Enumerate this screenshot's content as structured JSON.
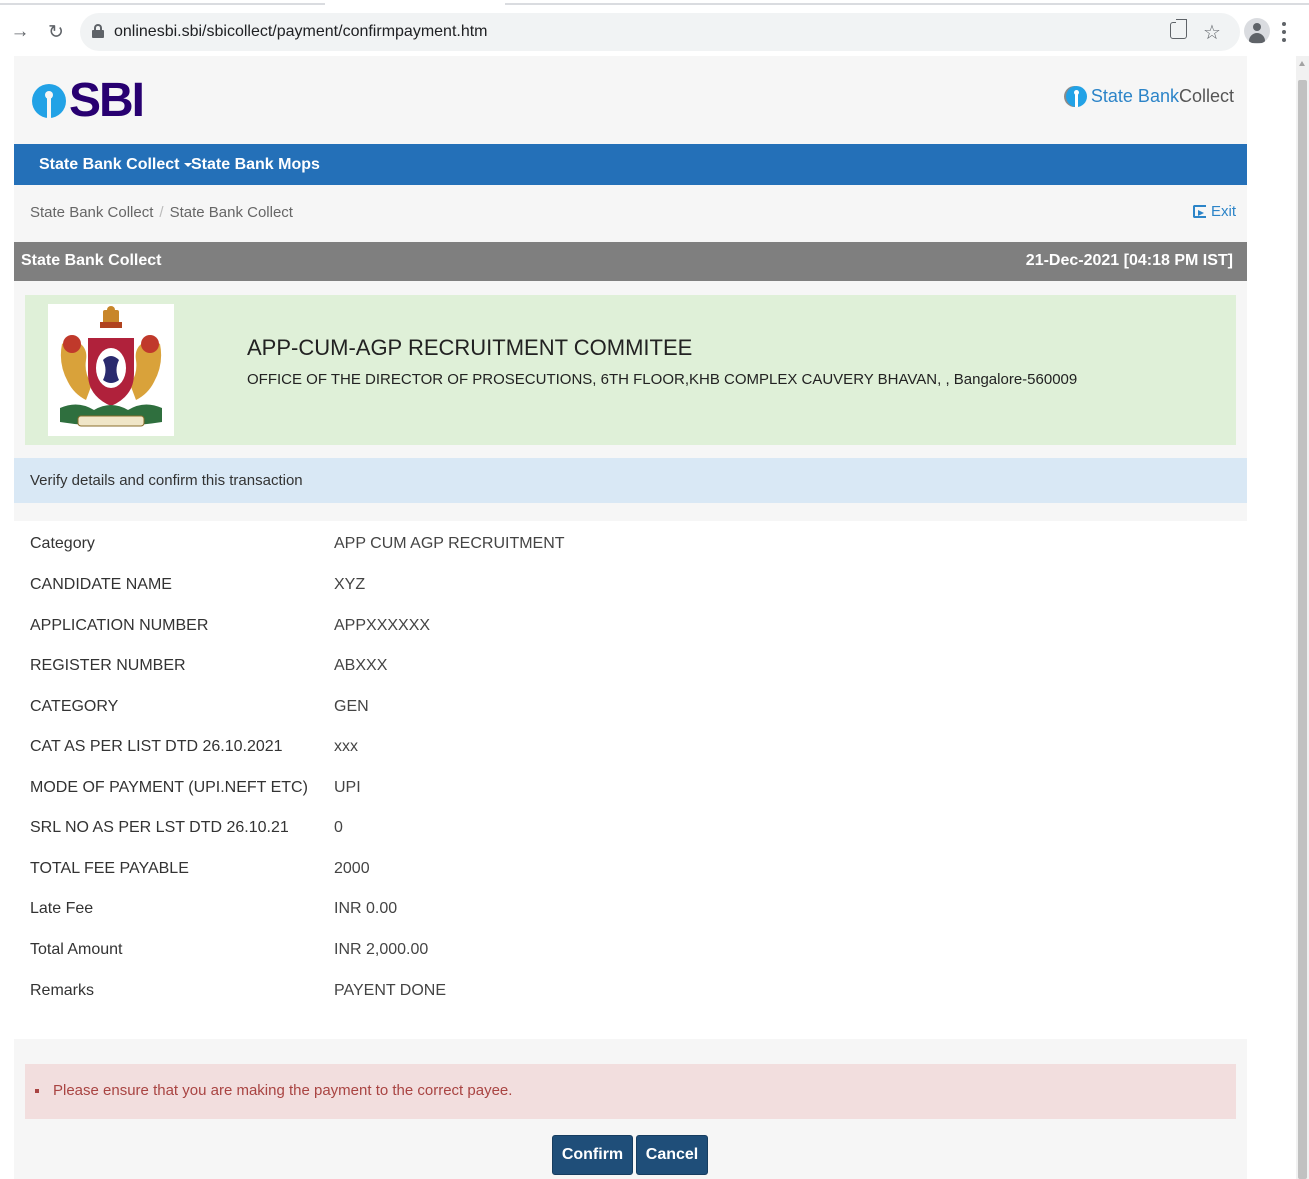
{
  "browser": {
    "url": "onlinesbi.sbi/sbicollect/payment/confirmpayment.htm"
  },
  "header": {
    "logo_text": "SBI",
    "brand_part1": "State Bank",
    "brand_part2": " Collect"
  },
  "navbar": {
    "items": [
      {
        "label": "State Bank Collect"
      },
      {
        "label": "State Bank Mops"
      }
    ]
  },
  "breadcrumb": {
    "items": [
      "State Bank Collect",
      "State Bank Collect"
    ],
    "separator": "/",
    "exit_label": "Exit"
  },
  "section": {
    "title": "State Bank Collect",
    "datetime": "21-Dec-2021 [04:18 PM IST]"
  },
  "payee": {
    "name": "APP-CUM-AGP RECRUITMENT COMMITEE",
    "address": "OFFICE OF THE DIRECTOR OF PROSECUTIONS, 6TH FLOOR,KHB COMPLEX CAUVERY BHAVAN, , Bangalore-560009"
  },
  "info": {
    "text": "Verify details and confirm this transaction"
  },
  "details": [
    {
      "label": "Category",
      "value": "APP CUM AGP RECRUITMENT"
    },
    {
      "label": "CANDIDATE NAME",
      "value": "XYZ"
    },
    {
      "label": "APPLICATION NUMBER",
      "value": "APPXXXXXX"
    },
    {
      "label": "REGISTER NUMBER",
      "value": "ABXXX"
    },
    {
      "label": "CATEGORY",
      "value": "GEN"
    },
    {
      "label": "CAT AS PER LIST DTD 26.10.2021",
      "value": "xxx"
    },
    {
      "label": "MODE OF PAYMENT (UPI.NEFT ETC)",
      "value": "UPI"
    },
    {
      "label": "SRL NO AS PER LST DTD 26.10.21",
      "value": "0"
    },
    {
      "label": "TOTAL FEE PAYABLE",
      "value": "2000"
    },
    {
      "label": "Late Fee",
      "value": "INR 0.00"
    },
    {
      "label": "Total Amount",
      "value": "INR 2,000.00"
    },
    {
      "label": "Remarks",
      "value": "PAYENT DONE"
    }
  ],
  "warning": {
    "text": "Please ensure that you are making the payment to the correct payee."
  },
  "actions": {
    "confirm_label": "Confirm",
    "cancel_label": "Cancel"
  },
  "colors": {
    "nav_blue": "#2470b8",
    "button_navy": "#1f4e79",
    "sbi_purple": "#280071",
    "sbi_cyan": "#22a2e6",
    "payee_green": "#dff0d8",
    "info_blue": "#d9e8f5",
    "warning_pink": "#f2dede"
  }
}
